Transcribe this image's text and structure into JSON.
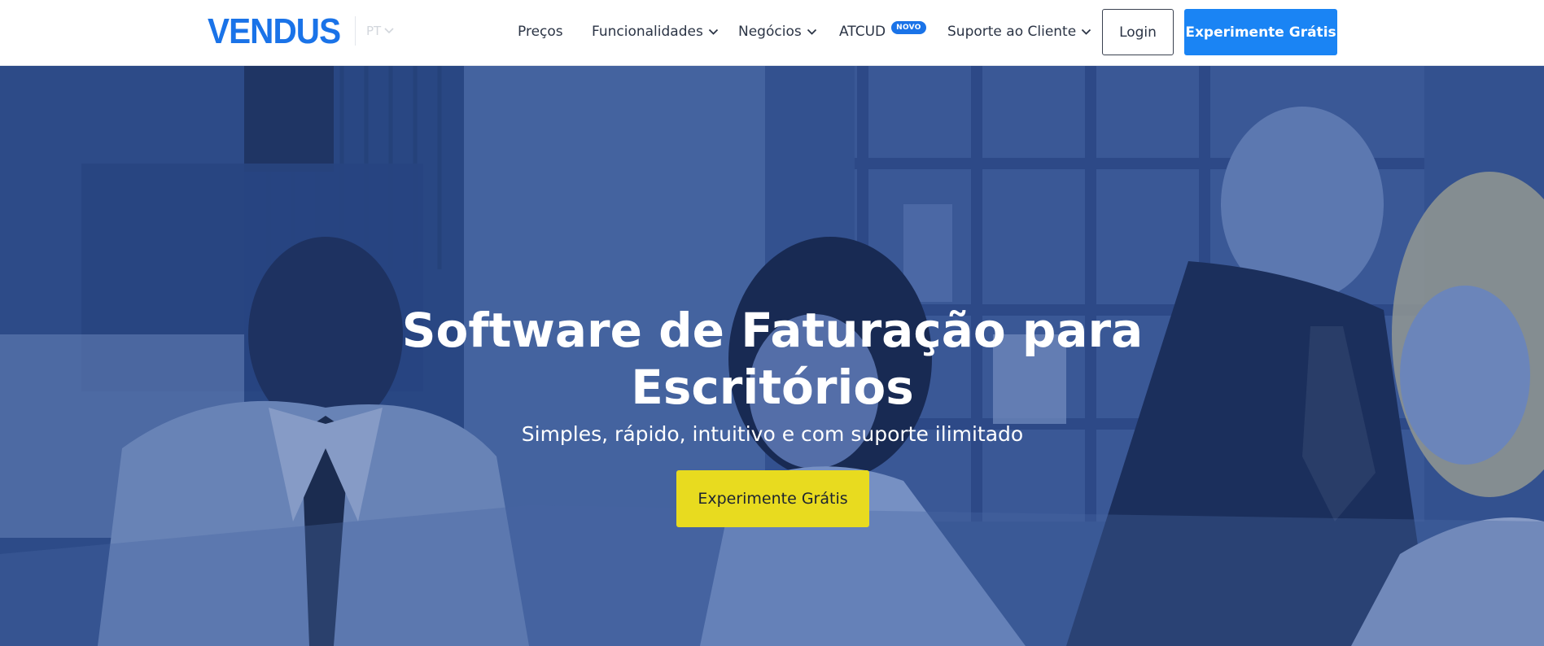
{
  "header": {
    "logo_text": "VENDUS",
    "language": "PT",
    "nav": [
      {
        "label": "Preços"
      },
      {
        "label": "Funcionalidades"
      },
      {
        "label": "Negócios"
      },
      {
        "label": "ATCUD",
        "badge": "NOVO"
      },
      {
        "label": "Suporte ao Cliente"
      }
    ],
    "login_label": "Login",
    "cta_label": "Experimente Grátis"
  },
  "hero": {
    "title_line1": "Software de Faturação para",
    "title_line2": "Escritórios",
    "subtitle": "Simples, rápido, intuitivo e com suporte ilimitado",
    "cta_label": "Experimente Grátis"
  },
  "colors": {
    "brand_blue": "#1a84f4",
    "logo_blue": "#1a73e8",
    "cta_yellow": "#e8db1f",
    "hero_tint": "#3b5a93"
  },
  "icons": [
    "chevron-down-icon"
  ]
}
